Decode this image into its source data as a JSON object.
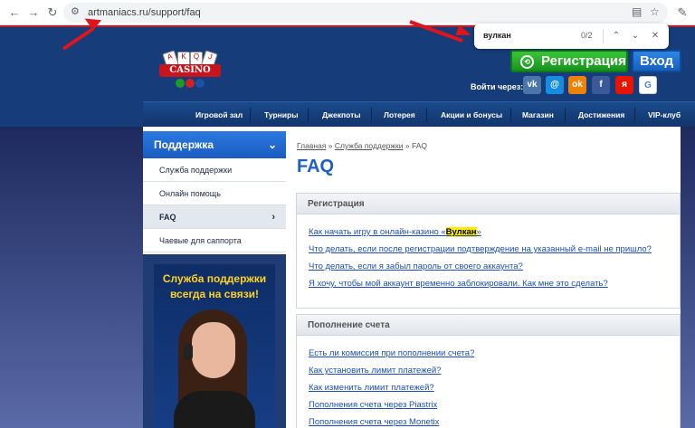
{
  "browser": {
    "url": "artmaniacs.ru/support/faq",
    "back_icon": "back-arrow-icon",
    "forward_icon": "forward-arrow-icon",
    "reload_icon": "reload-icon"
  },
  "find_bar": {
    "query": "вулкан",
    "count": "0/2"
  },
  "header": {
    "logo_text": "CASINO",
    "register_label": "Регистрация",
    "login_label": "Вход",
    "login_via_label": "Войти через:",
    "social": [
      {
        "name": "vk",
        "glyph": "vk",
        "color": "#4a76a8"
      },
      {
        "name": "mail",
        "glyph": "@",
        "color": "#168de2"
      },
      {
        "name": "ok",
        "glyph": "ok",
        "color": "#ee8208"
      },
      {
        "name": "facebook",
        "glyph": "f",
        "color": "#3b5998"
      },
      {
        "name": "yandex",
        "glyph": "я",
        "color": "#e61400"
      },
      {
        "name": "google",
        "glyph": "G",
        "color": "#ffffff"
      }
    ]
  },
  "nav": {
    "items": [
      "Игровой зал",
      "Турниры",
      "Джекпоты",
      "Лотерея",
      "Акции и бонусы",
      "Магазин",
      "Достижения",
      "VIP-клуб"
    ]
  },
  "sidebar": {
    "title": "Поддержка",
    "items": [
      {
        "label": "Служба поддержки"
      },
      {
        "label": "Онлайн помощь"
      },
      {
        "label": "FAQ"
      },
      {
        "label": "Чаевые для саппорта"
      }
    ],
    "banner_line1": "Служба поддержки",
    "banner_line2": "всегда на связи!"
  },
  "main": {
    "breadcrumb": {
      "home": "Главная",
      "sep1": "»",
      "support": "Служба поддержки",
      "sep2": "»",
      "current": "FAQ"
    },
    "title": "FAQ",
    "sections": [
      {
        "title": "Регистрация",
        "questions": [
          {
            "before": "Как начать игру в онлайн-казино «",
            "highlight": "Вулкан",
            "after": "»"
          },
          {
            "text": "Что делать, если после регистрации подтверждение на указанный e-mail не пришло?"
          },
          {
            "text": "Что делать, если я забыл пароль от своего аккаунта?"
          },
          {
            "text": "Я хочу, чтобы мой аккаунт временно заблокировали. Как мне это сделать?"
          }
        ]
      },
      {
        "title": "Пополнение счета",
        "questions": [
          {
            "text": "Есть ли комиссия при пополнении счета?"
          },
          {
            "text": "Как установить лимит платежей?"
          },
          {
            "text": "Как изменить лимит платежей?"
          },
          {
            "text": "Пополнения счета через Piastrix"
          },
          {
            "text": "Пополнения счета через Monetix"
          }
        ]
      }
    ]
  }
}
